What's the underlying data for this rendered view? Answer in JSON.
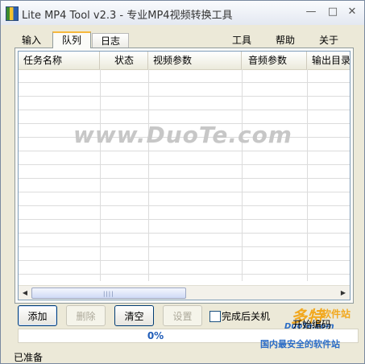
{
  "window": {
    "title": "Lite MP4 Tool v2.3 - 专业MP4视频转换工具",
    "min_glyph": "—",
    "max_glyph": "□",
    "close_glyph": "✕"
  },
  "tabs": [
    {
      "label": "输入",
      "active": false
    },
    {
      "label": "队列",
      "active": true
    },
    {
      "label": "日志",
      "active": false
    }
  ],
  "menu": {
    "tools": "工具",
    "help": "帮助",
    "about": "关于"
  },
  "table": {
    "columns": [
      "任务名称",
      "状态",
      "视频参数",
      "音频参数",
      "输出目录"
    ],
    "rows": []
  },
  "scroll": {
    "left_glyph": "◀",
    "right_glyph": "▶",
    "grip": "||||"
  },
  "watermark": "www.DuoTe.com",
  "buttons": {
    "add": "添加",
    "delete": "删除",
    "clear": "清空",
    "settings": "设置",
    "start": "开始编码"
  },
  "shutdown_checkbox": {
    "label": "完成后关机",
    "checked": false
  },
  "progress": {
    "text": "0%",
    "value": 0
  },
  "status": "已准备",
  "logo": {
    "line1": "多特",
    "line2": "软件站",
    "line3": "DuoTe.com",
    "line4": "国内最安全的软件站"
  },
  "colors": {
    "accent_tab": "#f6b83c",
    "progress_text": "#1f5cb8",
    "logo_orange": "#f2a81e",
    "logo_blue": "#2a6cc6"
  }
}
